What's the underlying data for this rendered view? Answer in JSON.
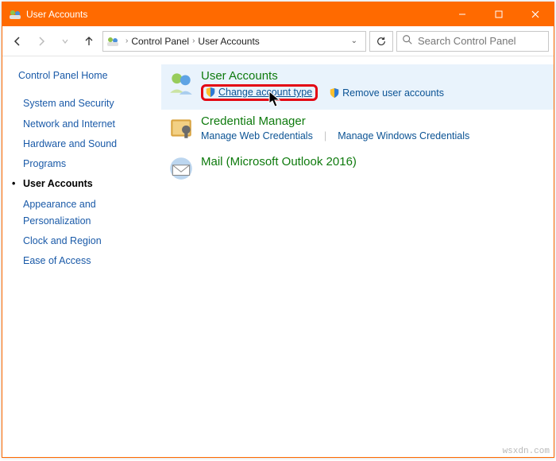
{
  "titlebar": {
    "title": "User Accounts"
  },
  "breadcrumb": {
    "root": "Control Panel",
    "current": "User Accounts"
  },
  "search": {
    "placeholder": "Search Control Panel"
  },
  "sidebar": {
    "home": "Control Panel Home",
    "items": [
      "System and Security",
      "Network and Internet",
      "Hardware and Sound",
      "Programs",
      "User Accounts",
      "Appearance and Personalization",
      "Clock and Region",
      "Ease of Access"
    ],
    "selected_index": 4
  },
  "sections": {
    "user_accounts": {
      "title": "User Accounts",
      "change_type": "Change account type",
      "remove": "Remove user accounts"
    },
    "credential": {
      "title": "Credential Manager",
      "web": "Manage Web Credentials",
      "win": "Manage Windows Credentials"
    },
    "mail": {
      "title": "Mail (Microsoft Outlook 2016)"
    }
  },
  "watermark": "wsxdn.com"
}
